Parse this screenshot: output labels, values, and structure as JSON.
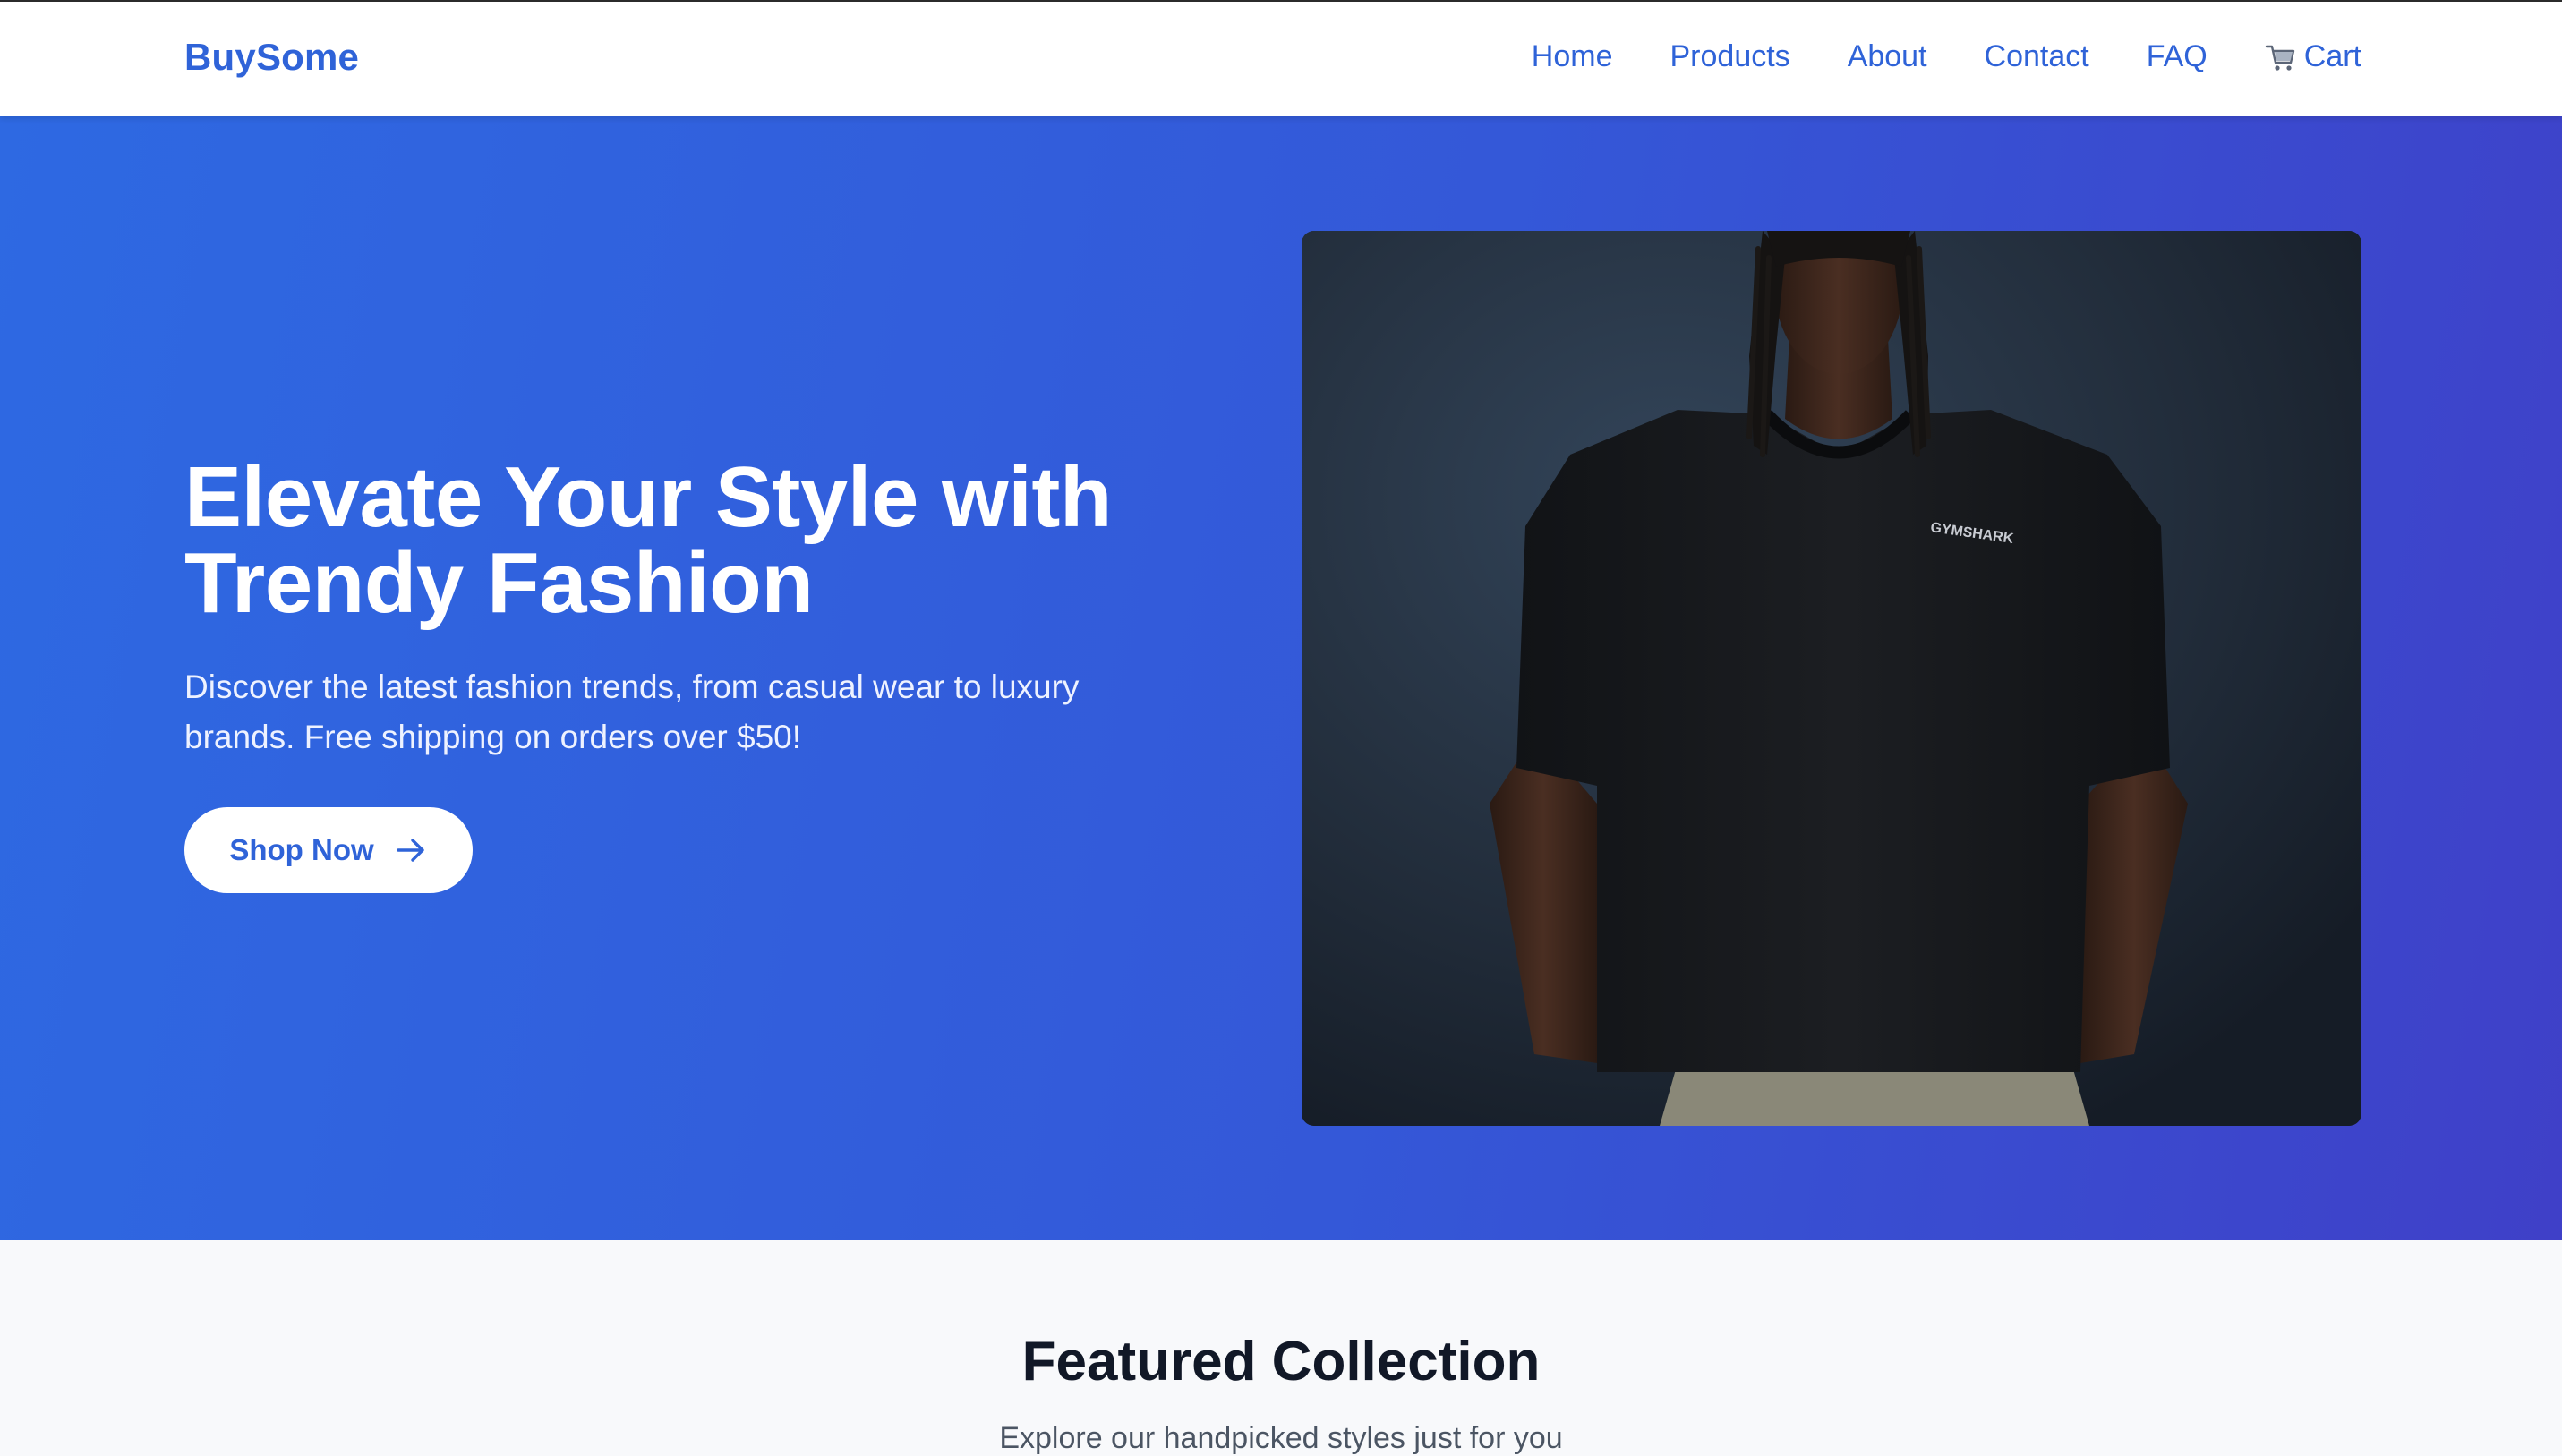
{
  "header": {
    "logo": "BuySome",
    "nav": [
      {
        "label": "Home"
      },
      {
        "label": "Products"
      },
      {
        "label": "About"
      },
      {
        "label": "Contact"
      },
      {
        "label": "FAQ"
      },
      {
        "label": "Cart",
        "icon": "shopping-cart-icon"
      }
    ]
  },
  "hero": {
    "title_line1": "Elevate Your Style with",
    "title_line2": "Trendy Fashion",
    "subtitle_line1": "Discover the latest fashion trends, from casual wear to luxury",
    "subtitle_line2": "brands. Free shipping on orders over $50!",
    "cta_label": "Shop Now",
    "cta_icon": "arrow-right-icon",
    "image_alt": "Model wearing black oversized t-shirt",
    "shirt_logo_text": "GYMSHARK"
  },
  "featured": {
    "title": "Featured Collection",
    "subtitle": "Explore our handpicked styles just for you"
  },
  "colors": {
    "brand": "#2f63d8",
    "hero_gradient_start": "#2e69e2",
    "hero_gradient_end": "#3f40c8",
    "heading_dark": "#111827"
  }
}
